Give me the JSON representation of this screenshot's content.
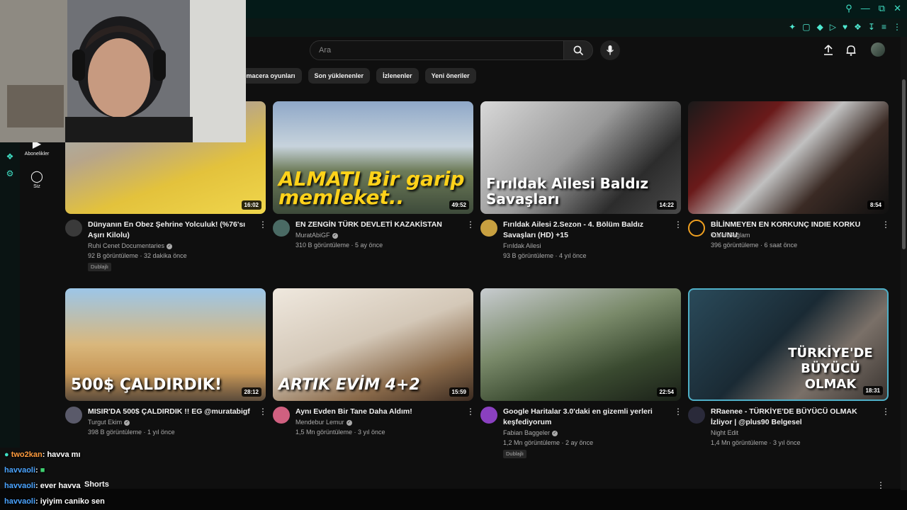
{
  "search": {
    "placeholder": "Ara"
  },
  "nav": [
    {
      "icon": "subscriptions-icon",
      "label": "Abonelikler"
    },
    {
      "icon": "you-icon",
      "label": "Siz"
    }
  ],
  "chips": [
    "n-macera oyunları",
    "Son yüklenenler",
    "İzlenenler",
    "Yeni öneriler"
  ],
  "videos": [
    {
      "title": "Dünyanın En Obez Şehrine Yolculuk! (%76'sı Aşırı Kilolu)",
      "channel": "Ruhi Cenet Documentaries",
      "verified": true,
      "meta": "92 B görüntüleme · 32 dakika önce",
      "duration": "16:02",
      "badge": "Dublajlı",
      "thumb_text": ""
    },
    {
      "title": "EN ZENGİN TÜRK DEVLETİ KAZAKİSTAN",
      "channel": "MuratAbiGF",
      "verified": true,
      "meta": "310 B görüntüleme · 5 ay önce",
      "duration": "49:52",
      "badge": "",
      "thumb_text": "ALMATI Bir garip memleket.."
    },
    {
      "title": "Fırıldak Ailesi 2.Sezon - 4. Bölüm Baldız Savaşları (HD) +15",
      "channel": "Fırıldak Ailesi",
      "verified": false,
      "meta": "93 B görüntüleme · 4 yıl önce",
      "duration": "14:22",
      "badge": "",
      "thumb_text": "Fırıldak Ailesi Baldız Savaşları"
    },
    {
      "title": "BİLİNMEYEN EN KORKUNÇ INDIE KORKU OYUNU",
      "channel": "Yusuf Sağlam",
      "verified": false,
      "meta": "396 görüntüleme · 6 saat önce",
      "duration": "8:54",
      "badge": "",
      "thumb_text": ""
    },
    {
      "title": "MISIR'DA 500$ ÇALDIRDIK !! EG @muratabigf",
      "channel": "Turgut Ekim",
      "verified": true,
      "meta": "398 B görüntüleme · 1 yıl önce",
      "duration": "28:12",
      "badge": "",
      "thumb_text": "500$ ÇALDIRDIK!"
    },
    {
      "title": "Aynı Evden Bir Tane Daha Aldım!",
      "channel": "Mendebur Lemur",
      "verified": true,
      "meta": "1,5 Mn görüntüleme · 3 yıl önce",
      "duration": "15:59",
      "badge": "",
      "thumb_text": "ARTIK EVİM 4+2"
    },
    {
      "title": "Google Haritalar 3.0'daki en gizemli yerleri keşfediyorum",
      "channel": "Fabian Baggeler",
      "verified": true,
      "meta": "1,2 Mn görüntüleme · 2 ay önce",
      "duration": "22:54",
      "badge": "Dublajlı",
      "thumb_text": ""
    },
    {
      "title": "RRaenee - TÜRKİYE'DE BÜYÜCÜ OLMAK İzliyor | @plus90 Belgesel",
      "channel": "Night Edit",
      "verified": false,
      "meta": "1,4 Mn görüntüleme · 3 yıl önce",
      "duration": "18:31",
      "badge": "",
      "thumb_text": "TÜRKİYE'DE BÜYÜCÜ OLMAK"
    }
  ],
  "colors": {
    "thumb1": "#c9a24a",
    "thumb2": "#4f6a8a",
    "thumb3": "#7a7a7a",
    "thumb4": "#3a2a2a",
    "thumb5": "#d9a868",
    "thumb6": "#b8b0a8",
    "thumb7": "#4f6a3a",
    "thumb8": "#2a3a44",
    "accent": "#3fe0c5"
  },
  "shorts_label": "Shorts",
  "chat": [
    {
      "user": "two2kan",
      "msg": ": havva mı",
      "user_color": "#ff9b3d"
    },
    {
      "user": "havvaoli",
      "msg": ": ",
      "user_color": "#4aa3ff"
    },
    {
      "user": "havvaoli",
      "msg": ": ever havva",
      "user_color": "#4aa3ff"
    },
    {
      "user": "havvaoli",
      "msg": ": iyiyim caniko sen",
      "user_color": "#4aa3ff"
    }
  ]
}
